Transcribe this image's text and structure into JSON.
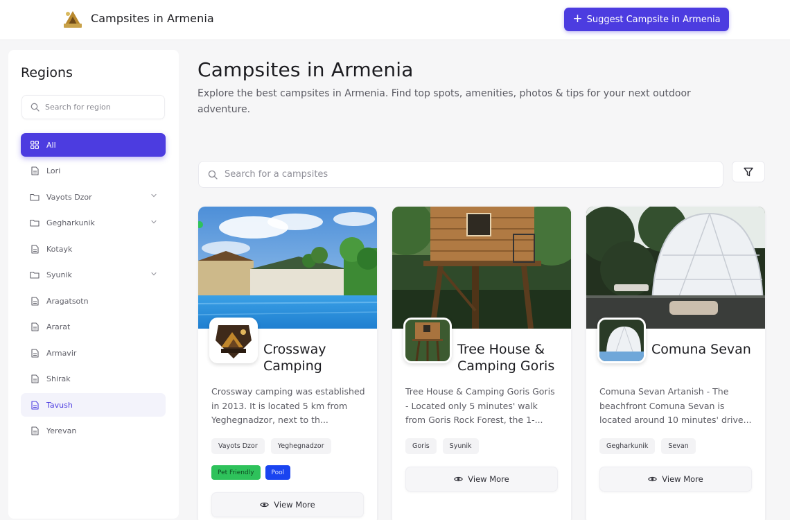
{
  "header": {
    "brand_title": "Campsites in Armenia",
    "suggest_label": "Suggest Campsite in Armenia",
    "accent_color": "#4c3ce0"
  },
  "sidebar": {
    "title": "Regions",
    "search_placeholder": "Search for region",
    "items": [
      {
        "label": "All",
        "icon": "grid-icon",
        "expandable": false,
        "state": "active"
      },
      {
        "label": "Lori",
        "icon": "document-icon",
        "expandable": false,
        "state": "normal"
      },
      {
        "label": "Vayots Dzor",
        "icon": "folder-icon",
        "expandable": true,
        "state": "normal"
      },
      {
        "label": "Gegharkunik",
        "icon": "folder-icon",
        "expandable": true,
        "state": "normal"
      },
      {
        "label": "Kotayk",
        "icon": "document-icon",
        "expandable": false,
        "state": "normal"
      },
      {
        "label": "Syunik",
        "icon": "folder-icon",
        "expandable": true,
        "state": "normal"
      },
      {
        "label": "Aragatsotn",
        "icon": "document-icon",
        "expandable": false,
        "state": "normal"
      },
      {
        "label": "Ararat",
        "icon": "document-icon",
        "expandable": false,
        "state": "normal"
      },
      {
        "label": "Armavir",
        "icon": "document-icon",
        "expandable": false,
        "state": "normal"
      },
      {
        "label": "Shirak",
        "icon": "document-icon",
        "expandable": false,
        "state": "normal"
      },
      {
        "label": "Tavush",
        "icon": "document-icon",
        "expandable": false,
        "state": "hover"
      },
      {
        "label": "Yerevan",
        "icon": "document-icon",
        "expandable": false,
        "state": "normal"
      }
    ]
  },
  "main": {
    "title": "Campsites in Armenia",
    "description": "Explore the best campsites in Armenia. Find top spots, amenities, photos & tips for your next outdoor adventure.",
    "search_placeholder": "Search for a campsites",
    "view_more_label": "View More",
    "cards": [
      {
        "name": "Crossway Camping",
        "description": "Crossway camping was established in 2013. It is located 5 km from Yeghegnadzor, next to th...",
        "tags": [
          "Vayots Dzor",
          "Yeghegnadzor"
        ],
        "badges": [
          {
            "label": "Pet Friendly",
            "color": "#2ec25b"
          },
          {
            "label": "Pool",
            "color": "#1a44f0"
          }
        ]
      },
      {
        "name": "Tree House & Camping Goris",
        "description": "Tree House & Camping Goris Goris - Located only 5 minutes' walk from Goris Rock Forest, the 1-...",
        "tags": [
          "Goris",
          "Syunik"
        ],
        "badges": []
      },
      {
        "name": "Comuna Sevan",
        "description": "Comuna Sevan Artanish - The beachfront Comuna Sevan is located around 10 minutes' drive...",
        "tags": [
          "Gegharkunik",
          "Sevan"
        ],
        "badges": []
      }
    ]
  }
}
